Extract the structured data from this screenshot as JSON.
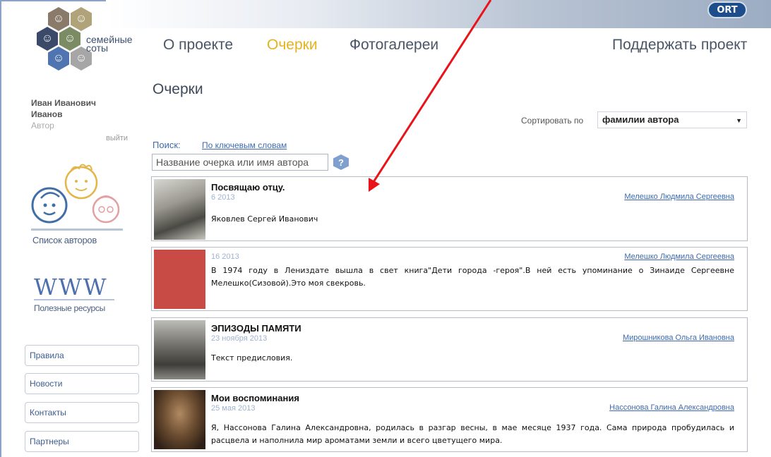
{
  "header": {
    "partner_logo": "ORT",
    "logo_text_line1": "семейные",
    "logo_text_line2": "соты"
  },
  "user": {
    "first_names": "Иван Иванович",
    "last_name": "Иванов",
    "role": "Автор",
    "logout": "выйти"
  },
  "sidebar": {
    "authors_list": "Список авторов",
    "www": "WWW",
    "resources": "Полезные ресурсы",
    "buttons": [
      {
        "label": "Правила"
      },
      {
        "label": "Новости"
      },
      {
        "label": "Контакты"
      },
      {
        "label": "Партнеры"
      }
    ]
  },
  "nav": {
    "about": "О проекте",
    "essays": "Очерки",
    "galleries": "Фотогалереи",
    "support": "Поддержать проект",
    "active": "essays"
  },
  "page": {
    "title": "Очерки",
    "sort_label": "Сортировать по",
    "sort_value": "фамилии автора"
  },
  "search": {
    "label": "Поиск:",
    "link": "По ключевым словам",
    "placeholder": "Название очерка или имя автора"
  },
  "essays": [
    {
      "title": "Посвящаю отцу.",
      "date": "6 2013",
      "author": "Мелешко Людмила Сергеевна",
      "text": "Яковлев Сергей Иванович"
    },
    {
      "title": "",
      "date": "16 2013",
      "author": "Мелешко Людмила Сергеевна",
      "text": "В 1974 году в Лениздате вышла в свет книга\"Дети города -героя\".В ней есть упоминание о Зинаиде Сергеевне Мелешко(Сизовой).Это моя свекровь."
    },
    {
      "title": "ЭПИЗОДЫ  ПАМЯТИ",
      "date": "23 ноября 2013",
      "author": "Мирошникова Ольга Ивановна",
      "text": "Текст предисловия."
    },
    {
      "title": "Мои воспоминания",
      "date": "25 мая 2013",
      "author": "Нассонова Галина Александровна",
      "text": "Я, Нассонова Галина Александровна, родилась в разгар весны, в мае месяце 1937 года. Сама природа пробудилась и расцвела и наполнила мир ароматами земли и всего цветущего мира."
    }
  ],
  "colors": {
    "accent": "#e6b21e",
    "link": "#3d6ab0",
    "annotation_arrow": "#e8141a"
  }
}
